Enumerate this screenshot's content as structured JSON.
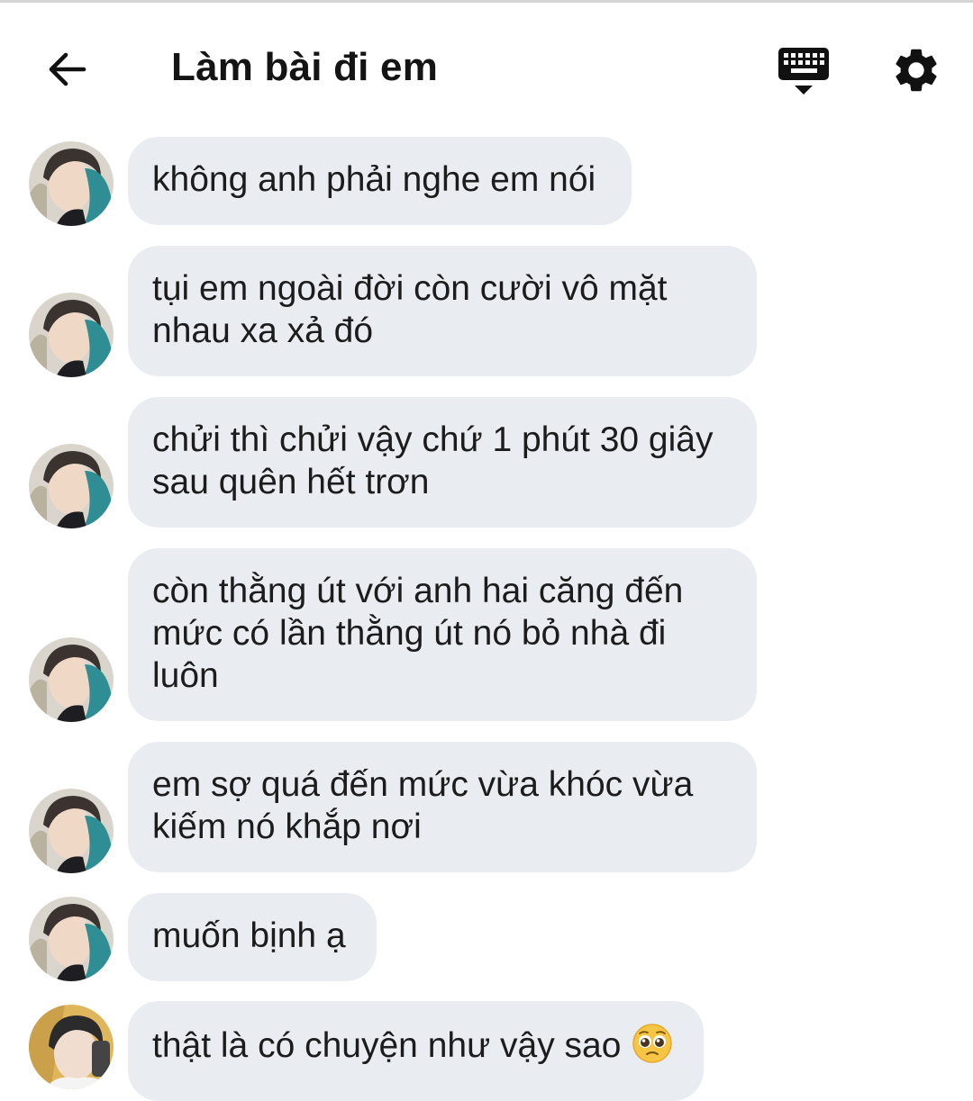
{
  "header": {
    "title": "Làm bài đi em",
    "back_icon": "arrow-left-icon",
    "keyboard_icon": "keyboard-icon",
    "settings_icon": "gear-icon"
  },
  "messages": [
    {
      "text": "không anh phải nghe em nói",
      "sender": "other"
    },
    {
      "text": "tụi em ngoài đời còn cười vô mặt nhau xa xả đó",
      "sender": "other"
    },
    {
      "text": "chửi thì chửi vậy chứ 1 phút 30 giây sau quên hết trơn",
      "sender": "other"
    },
    {
      "text": "còn thằng út với anh hai căng đến mức có lần thằng út nó bỏ nhà đi luôn",
      "sender": "other"
    },
    {
      "text": "em sợ quá đến mức vừa khóc vừa kiếm nó khắp nơi",
      "sender": "other"
    },
    {
      "text": "muốn bịnh ạ",
      "sender": "other"
    },
    {
      "text": "thật là có chuyện như vậy sao",
      "sender": "self",
      "emoji": "pleading-face-emoji"
    }
  ],
  "colors": {
    "bubble": "#e9ecf1",
    "text": "#1c1c1c",
    "icon": "#111111"
  }
}
